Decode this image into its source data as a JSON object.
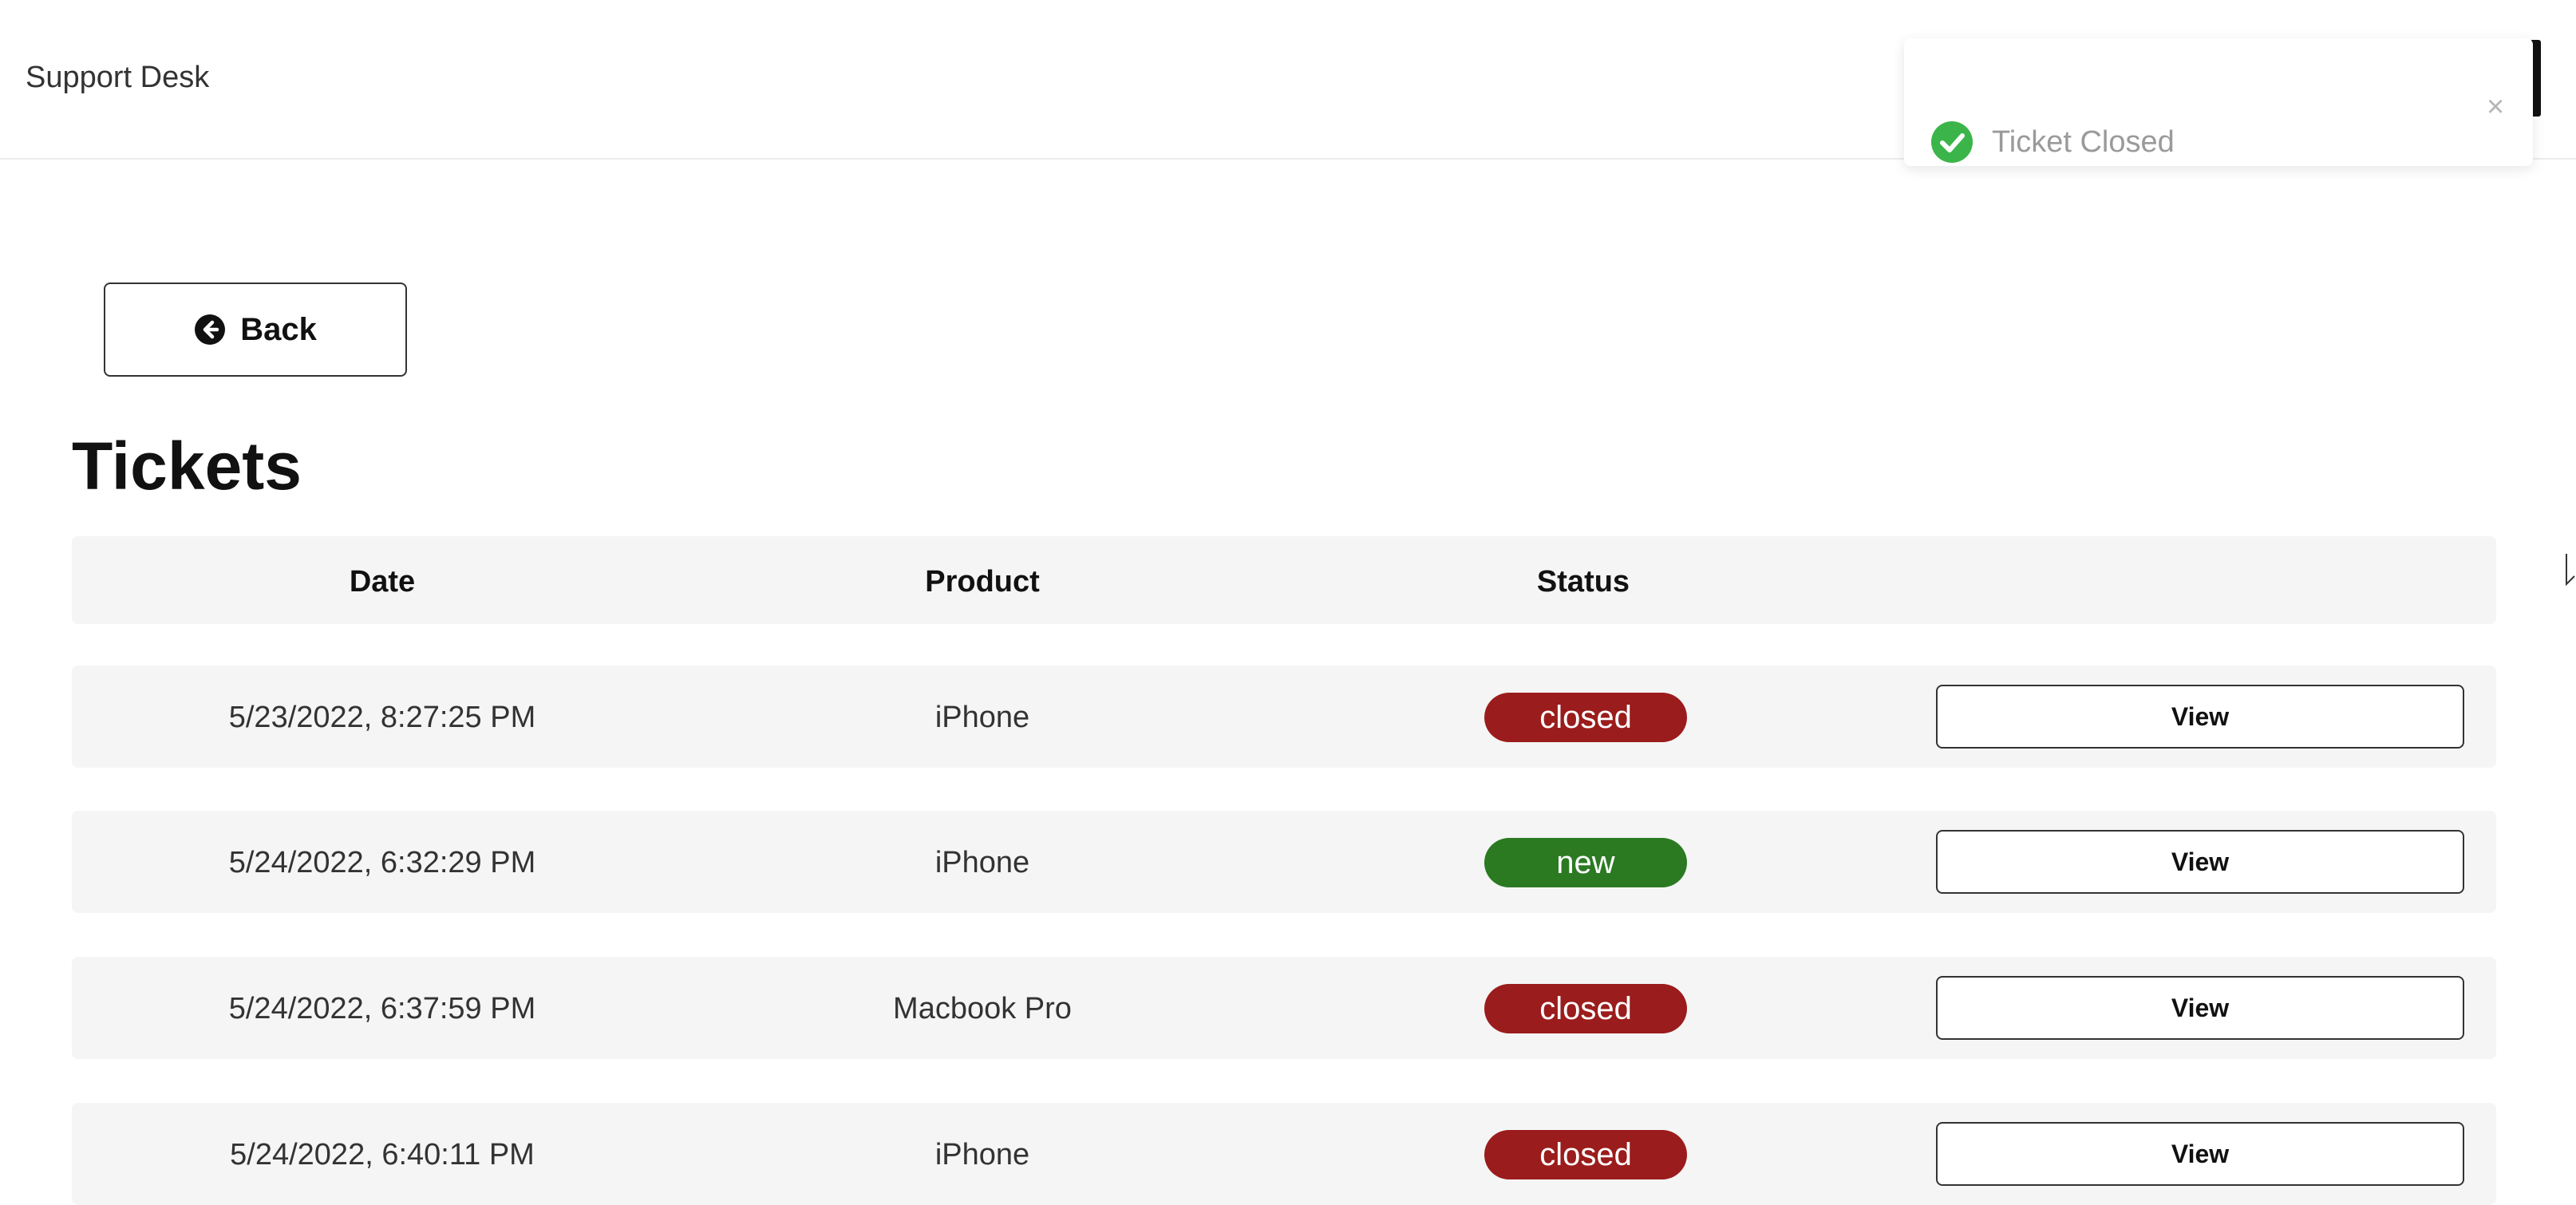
{
  "header": {
    "brand": "Support Desk"
  },
  "toast": {
    "message": "Ticket Closed",
    "close_glyph": "×",
    "icon": "check-circle-icon",
    "icon_color": "#3bb54a"
  },
  "back_button": {
    "label": "Back",
    "icon": "arrow-left-circle-icon"
  },
  "page_title": "Tickets",
  "table": {
    "headers": {
      "date": "Date",
      "product": "Product",
      "status": "Status"
    },
    "rows": [
      {
        "date": "5/23/2022, 8:27:25 PM",
        "product": "iPhone",
        "status": "closed",
        "action": "View"
      },
      {
        "date": "5/24/2022, 6:32:29 PM",
        "product": "iPhone",
        "status": "new",
        "action": "View"
      },
      {
        "date": "5/24/2022, 6:37:59 PM",
        "product": "Macbook Pro",
        "status": "closed",
        "action": "View"
      },
      {
        "date": "5/24/2022, 6:40:11 PM",
        "product": "iPhone",
        "status": "closed",
        "action": "View"
      }
    ]
  },
  "colors": {
    "status_closed": "#9b1c1c",
    "status_new": "#2b7a22",
    "row_background": "#f5f5f5"
  }
}
